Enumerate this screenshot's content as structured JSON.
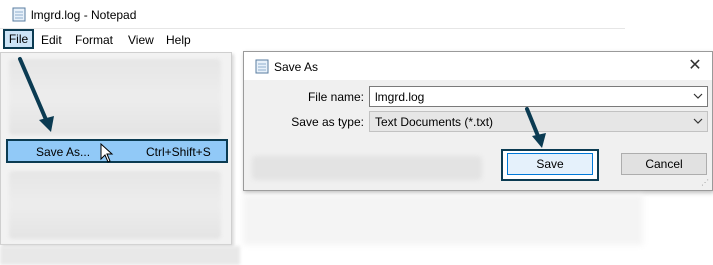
{
  "notepad": {
    "title": "lmgrd.log - Notepad",
    "menu": [
      "File",
      "Edit",
      "Format",
      "View",
      "Help"
    ],
    "file_menu": {
      "save_as_label": "Save As...",
      "save_as_shortcut": "Ctrl+Shift+S"
    }
  },
  "dialog": {
    "title": "Save As",
    "close_glyph": "✕",
    "file_name_label": "File name:",
    "file_name_value": "lmgrd.log",
    "save_as_type_label": "Save as type:",
    "save_as_type_value": "Text Documents (*.txt)",
    "save_label": "Save",
    "cancel_label": "Cancel"
  },
  "colors": {
    "highlight_outline": "#0b3b52",
    "menu_highlight": "#91c9f7"
  }
}
